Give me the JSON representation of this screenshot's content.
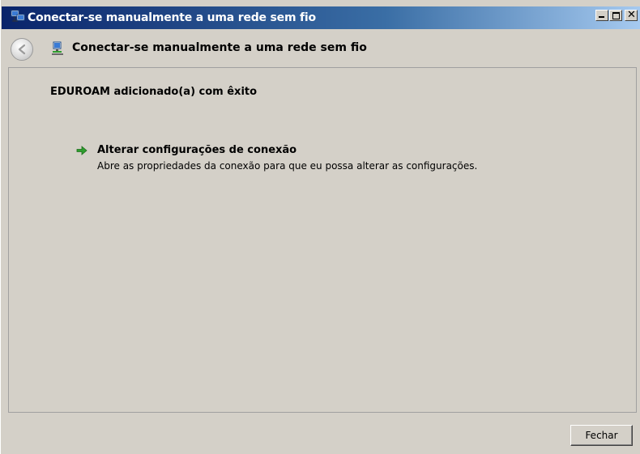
{
  "window": {
    "title": "Conectar-se manualmente a uma rede sem fio",
    "controls": [
      "minimize",
      "maximize",
      "close"
    ]
  },
  "header": {
    "title": "Conectar-se manualmente a uma rede sem fio",
    "back_icon": "back-arrow-icon",
    "network_icon": "network-icon"
  },
  "content": {
    "success_message": "EDUROAM adicionado(a) com êxito",
    "link": {
      "title": "Alterar configurações de conexão",
      "description": "Abre as propriedades da conexão para que eu possa alterar as configurações.",
      "icon": "green-arrow-icon"
    }
  },
  "footer": {
    "close_label": "Fechar"
  },
  "colors": {
    "titlebar_start": "#0a246a",
    "titlebar_end": "#a6caf0",
    "background": "#d4d0c8",
    "arrow_green": "#2e9e2e"
  }
}
